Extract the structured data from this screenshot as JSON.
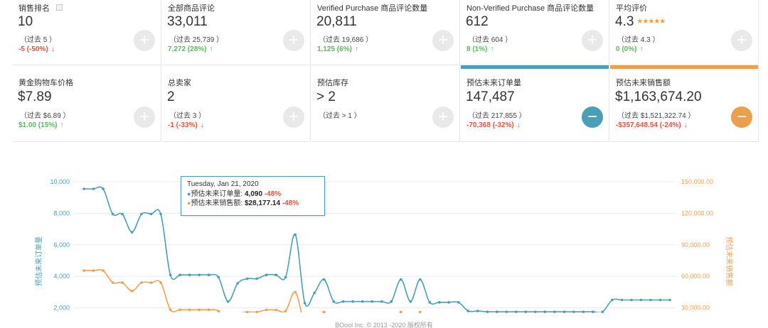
{
  "cards_row1": [
    {
      "label": "销售排名",
      "value": "10",
      "prev": "（过去 5 ）",
      "change": "-5 (-50%)",
      "dir": "down",
      "button": "+"
    },
    {
      "label": "全部商品评论",
      "value": "33,011",
      "prev": "（过去 25,739 ）",
      "change": "7,272 (28%)",
      "dir": "up",
      "button": "+"
    },
    {
      "label": "Verified Purchase 商品评论数量",
      "value": "20,811",
      "prev": "（过去 19,686 ）",
      "change": "1,125 (6%)",
      "dir": "up",
      "button": "+"
    },
    {
      "label": "Non-Verified Purchase 商品评论数量",
      "value": "612",
      "prev": "（过去 604 ）",
      "change": "8 (1%)",
      "dir": "up",
      "button": "+"
    },
    {
      "label": "平均评价",
      "value": "4.3",
      "prev": "（过去 4.3 ）",
      "change": "0 (0%)",
      "dir": "up",
      "button": "+",
      "stars": "★★★★★"
    }
  ],
  "cards_row2": [
    {
      "label": "黄金购物车价格",
      "value": "$7.89",
      "prev": "（过去 $6.89 ）",
      "change": "$1.00 (15%)",
      "dir": "up",
      "button": "+"
    },
    {
      "label": "总卖家",
      "value": "2",
      "prev": "（过去 3 ）",
      "change": "-1 (-33%)",
      "dir": "down",
      "button": "+"
    },
    {
      "label": "预估库存",
      "value": "> 2",
      "prev": "（过去 > 1 ）",
      "change": "",
      "dir": "up",
      "button": "+"
    },
    {
      "label": "预估未来订单量",
      "value": "147,487",
      "prev": "（过去 217,855 ）",
      "change": "-70,368 (-32%)",
      "dir": "down",
      "button": "−",
      "accent": "#4a9eb6"
    },
    {
      "label": "预估未来销售额",
      "value": "$1,163,674.20",
      "prev": "（过去 $1,521,322.74 ）",
      "change": "-$357,648.54 (-24%)",
      "dir": "down",
      "button": "−",
      "accent": "#eca04b"
    }
  ],
  "arrows": {
    "up": "↑",
    "down": "↓"
  },
  "tooltip": {
    "date": "Tuesday, Jan 21, 2020",
    "row1_label": "预估未来订单量:",
    "row1_value": "4,090",
    "row1_change": "-48%",
    "row2_label": "预估未来销售额:",
    "row2_value": "$28,177.14",
    "row2_change": "-48%"
  },
  "footer": "BOool Inc. © 2013 -2020 版权所有",
  "chart_data": {
    "type": "line",
    "ylabel_left": "预估未来订单量",
    "ylabel_right": "预估未来销售额",
    "left_ticks": [
      "10,000",
      "8,000",
      "6,000",
      "4,000",
      "2,000"
    ],
    "right_ticks": [
      "150,000.00",
      "120,000.00",
      "90,000.00",
      "60,000.00",
      "30,000.00"
    ],
    "ylim_left": [
      0,
      10000
    ],
    "ylim_right": [
      0,
      150000
    ],
    "colors": {
      "orders": "#4a9eb6",
      "sales": "#f0a050",
      "left_axis": "#4a9eb6",
      "right_axis": "#f0a050"
    },
    "series": [
      {
        "name": "预估未来订单量",
        "axis": "left",
        "values": [
          9550,
          9550,
          9550,
          7950,
          7950,
          6800,
          7950,
          7950,
          7950,
          4090,
          4090,
          4090,
          4090,
          4090,
          3950,
          2400,
          3550,
          3850,
          3850,
          4090,
          4090,
          3950,
          6650,
          2300,
          2950,
          3800,
          2400,
          2400,
          2400,
          2400,
          2400,
          2400,
          2400,
          3800,
          2400,
          3800,
          2350,
          2350,
          2350,
          2350,
          1800,
          1800,
          1750,
          1750,
          1750,
          1750,
          1750,
          1750,
          1750,
          1750,
          1750,
          1750,
          1750,
          1750,
          1750,
          2500,
          2500,
          2500,
          2500,
          2500,
          2500,
          2500
        ]
      },
      {
        "name": "预估未来销售额",
        "axis": "right",
        "values": [
          65500,
          65500,
          65500,
          54000,
          54000,
          46000,
          54000,
          54000,
          54000,
          28177,
          28177,
          28177,
          28177,
          28177,
          27000,
          16500,
          24000,
          26000,
          26000,
          28000,
          28000,
          27000,
          45000,
          15500,
          20000,
          26000,
          16500,
          16500,
          16500,
          16500,
          16500,
          16500,
          16500,
          26000,
          16500,
          26000,
          16000,
          16000,
          16000,
          16000,
          12300,
          12300,
          12000,
          12000,
          12000,
          12000,
          12000,
          12000,
          12000,
          12000,
          12000,
          12000,
          12000,
          12000,
          12000,
          17000,
          17000,
          17000,
          17000,
          17000,
          17000,
          17000
        ]
      }
    ]
  }
}
